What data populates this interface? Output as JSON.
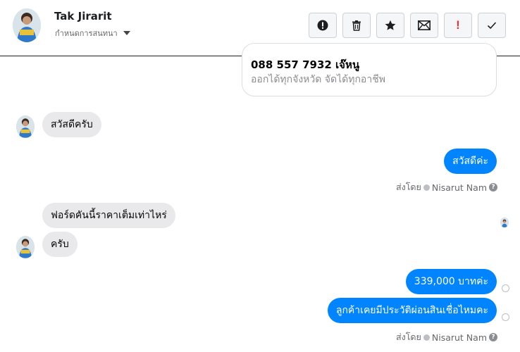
{
  "header": {
    "contact_name": "Tak Jirarit",
    "subtitle": "กำหนดการสนทนา",
    "toolbar": [
      {
        "icon": "alert-circle-icon",
        "name": "mark-spam-button"
      },
      {
        "icon": "trash-icon",
        "name": "delete-button"
      },
      {
        "icon": "star-icon",
        "name": "star-button"
      },
      {
        "icon": "envelope-icon",
        "name": "mark-unread-button"
      },
      {
        "icon": "exclamation-icon",
        "name": "follow-up-button",
        "glyph": "!"
      },
      {
        "icon": "check-icon",
        "name": "done-button"
      }
    ]
  },
  "card": {
    "title": "088 557 7932 เจ๊หนู",
    "subtitle": "ออกได้ทุกจังหวัด จัดได้ทุกอาชีพ"
  },
  "messages": [
    {
      "side": "in",
      "text": "สวัสดีครับ"
    },
    {
      "side": "out",
      "text": "สวัสดีค่ะ"
    },
    {
      "side": "in",
      "text": "ฟอร์ดคันนี้ราคาเต็มเท่าไหร่"
    },
    {
      "side": "in",
      "text": "ครับ"
    },
    {
      "side": "out",
      "text": "339,000 บาทค่ะ"
    },
    {
      "side": "out",
      "text": "ลูกค้าเคยมีประวัติผ่อนสินเชื่อไหมคะ"
    }
  ],
  "sent_by": {
    "prefix": "ส่งโดย",
    "name": "Nisarut Nam"
  },
  "colors": {
    "outgoing": "#0084ff",
    "incoming": "#e9e9eb",
    "secondary_text": "#65676b"
  }
}
